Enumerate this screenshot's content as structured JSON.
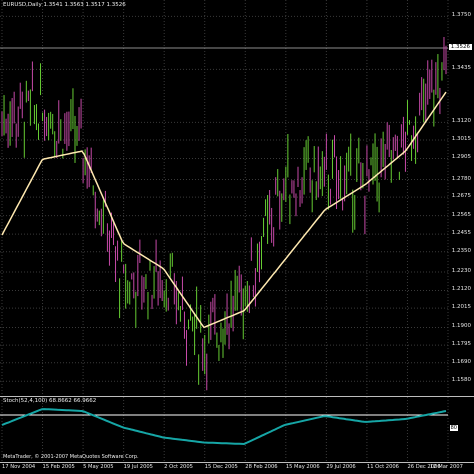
{
  "header": {
    "symbol_info": "EURUSD,Daily  1.3541 1.3563 1.3517 1.3526",
    "current_price": "1.3526"
  },
  "price_axis": {
    "labels": [
      "1.3750",
      "1.3435",
      "1.3120",
      "1.3015",
      "1.2905",
      "1.2780",
      "1.2675",
      "1.2565",
      "1.2455",
      "1.2350",
      "1.2230",
      "1.2120",
      "1.2015",
      "1.1900",
      "1.1795",
      "1.1690",
      "1.1580"
    ]
  },
  "time_axis": {
    "labels": [
      "17 Nov 2004",
      "15 Feb 2005",
      "5 May 2005",
      "19 Jul 2005",
      "2 Oct 2005",
      "15 Dec 2005",
      "28 Feb 2006",
      "15 May 2006",
      "29 Jul 2006",
      "11 Oct 2006",
      "26 Dec 2006",
      "12 Mar 2007"
    ]
  },
  "oscillator": {
    "title": "Stoch(52,4,100) 68.8662 66.9662",
    "level_label": "80",
    "copyright": "MetaTrader, © 2001-2007 MetaQuotes Software Corp."
  },
  "colors": {
    "background": "#000000",
    "grid": "#3a3a3a",
    "bull_candle": "#66cc33",
    "bear_candle": "#c64aa8",
    "moving_average": "#ffe9b0",
    "oscillator_main": "#16a6a6",
    "oscillator_level": "#ffffff"
  },
  "chart_data": {
    "type": "line",
    "title": "EURUSD,Daily",
    "x": [
      "17 Nov 2004",
      "15 Feb 2005",
      "5 May 2005",
      "19 Jul 2005",
      "2 Oct 2005",
      "15 Dec 2005",
      "28 Feb 2006",
      "15 May 2006",
      "29 Jul 2006",
      "11 Oct 2006",
      "26 Dec 2006",
      "12 Mar 2007"
    ],
    "series": [
      {
        "values": [
          1.315,
          1.32,
          1.3,
          1.215,
          1.22,
          1.18,
          1.21,
          1.275,
          1.28,
          1.275,
          1.3,
          1.345
        ]
      },
      {
        "values": [
          1.245,
          1.29,
          1.295,
          1.24,
          1.225,
          1.19,
          1.2,
          1.23,
          1.26,
          1.275,
          1.295,
          1.33
        ]
      }
    ],
    "ylim": [
      1.154,
      1.38
    ],
    "oscillator_values": [
      60,
      92,
      88,
      55,
      35,
      25,
      22,
      60,
      78,
      66,
      72,
      88
    ],
    "oscillator_level": 80,
    "grid": true
  }
}
